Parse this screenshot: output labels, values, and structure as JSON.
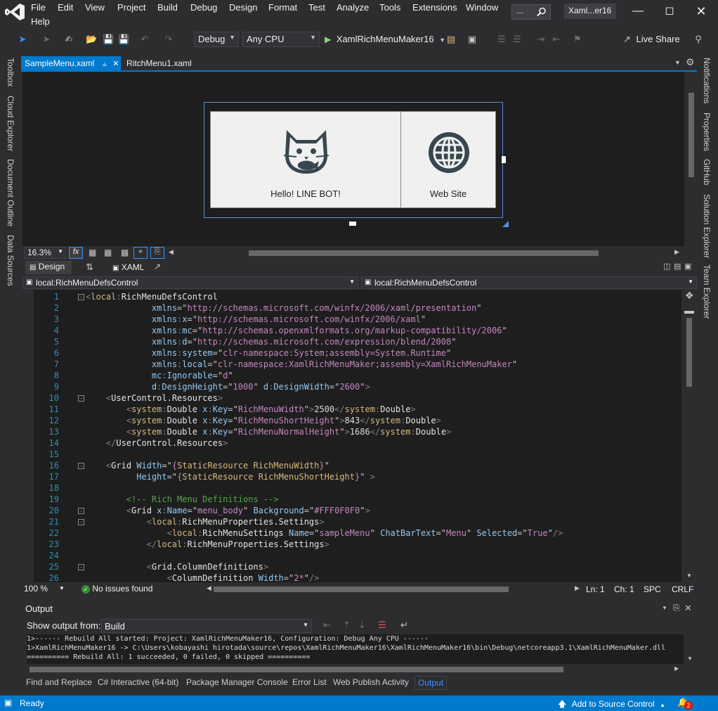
{
  "menubar": {
    "items": [
      "File",
      "Edit",
      "View",
      "Project",
      "Build",
      "Debug",
      "Design",
      "Format",
      "Test",
      "Analyze",
      "Tools",
      "Extensions",
      "Window",
      "Help"
    ],
    "search_label": "...",
    "solution_name": "Xaml...er16"
  },
  "toolbar": {
    "configuration": "Debug",
    "platform": "Any CPU",
    "start_target": "XamlRichMenuMaker16",
    "live_share": "Live Share"
  },
  "left_tabs": [
    "Toolbox",
    "Cloud Explorer",
    "Document Outline",
    "Data Sources"
  ],
  "right_tabs": [
    "Notifications",
    "Properties",
    "GitHub",
    "Solution Explorer",
    "Team Explorer"
  ],
  "doc_tabs": [
    {
      "label": "SampleMenu.xaml",
      "pin": "⫨"
    },
    {
      "label": "RitchMenu1.xaml"
    }
  ],
  "designer": {
    "cells": [
      {
        "label": "Hello! LINE BOT!",
        "icon": "cat-icon"
      },
      {
        "label": "Web Site",
        "icon": "globe-icon"
      }
    ],
    "zoom": "16.3%",
    "fx_label": "fx"
  },
  "split": {
    "design_label": "Design",
    "xaml_label": "XAML"
  },
  "nav": {
    "left_scope": "local:RichMenuDefsControl",
    "right_scope": "local:RichMenuDefsControl"
  },
  "code_lines": [
    {
      "n": "1",
      "fold": "-",
      "html": "<span class='c-bracket'>&lt;</span><span class='c-ns'>local</span><span class='c-bracket'>:</span><span class='c-tag'>RichMenuDefsControl</span>"
    },
    {
      "n": "2",
      "html": "             <span class='c-attr'>xmlns</span><span class='c-q'>=</span><span class='c-q'>\"</span><span class='c-str'>http://schemas.microsoft.com/winfx/2006/xaml/presentation</span><span class='c-q'>\"</span>"
    },
    {
      "n": "3",
      "html": "             <span class='c-attr'>xmlns</span><span class='c-bracket'>:</span><span class='c-attr'>x</span><span class='c-q'>=\"</span><span class='c-str'>http://schemas.microsoft.com/winfx/2006/xaml</span><span class='c-q'>\"</span>"
    },
    {
      "n": "4",
      "html": "             <span class='c-attr'>xmlns</span><span class='c-bracket'>:</span><span class='c-attr'>mc</span><span class='c-q'>=\"</span><span class='c-str'>http://schemas.openxmlformats.org/markup-compatibility/2006</span><span class='c-q'>\"</span>"
    },
    {
      "n": "5",
      "html": "             <span class='c-attr'>xmlns</span><span class='c-bracket'>:</span><span class='c-attr'>d</span><span class='c-q'>=\"</span><span class='c-str'>http://schemas.microsoft.com/expression/blend/2008</span><span class='c-q'>\"</span>"
    },
    {
      "n": "6",
      "html": "             <span class='c-attr'>xmlns</span><span class='c-bracket'>:</span><span class='c-attr'>system</span><span class='c-q'>=\"</span><span class='c-str'>clr-namespace:System;assembly=System.Runtime</span><span class='c-q'>\"</span>"
    },
    {
      "n": "7",
      "html": "             <span class='c-attr'>xmlns</span><span class='c-bracket'>:</span><span class='c-attr'>local</span><span class='c-q'>=\"</span><span class='c-str'>clr-namespace:XamlRichMenuMaker;assembly=XamlRichMenuMaker</span><span class='c-q'>\"</span>"
    },
    {
      "n": "8",
      "html": "             <span class='c-attr'>mc</span><span class='c-bracket'>:</span><span class='c-attr'>Ignorable</span><span class='c-q'>=\"</span><span class='c-str'>d</span><span class='c-q'>\"</span>"
    },
    {
      "n": "9",
      "html": "             <span class='c-attr'>d</span><span class='c-bracket'>:</span><span class='c-attr'>DesignHeight</span><span class='c-q'>=\"</span><span class='c-str'>1000</span><span class='c-q'>\"</span> <span class='c-attr'>d</span><span class='c-bracket'>:</span><span class='c-attr'>DesignWidth</span><span class='c-q'>=\"</span><span class='c-str'>2600</span><span class='c-q'>\"</span><span class='c-bracket'>&gt;</span>"
    },
    {
      "n": "10",
      "fold": "-",
      "html": "    <span class='c-bracket'>&lt;</span><span class='c-tag'>UserControl.Resources</span><span class='c-bracket'>&gt;</span>"
    },
    {
      "n": "11",
      "html": "        <span class='c-bracket'>&lt;</span><span class='c-ns'>system</span><span class='c-bracket'>:</span><span class='c-tag'>Double</span> <span class='c-attr'>x</span><span class='c-bracket'>:</span><span class='c-attr'>Key</span><span class='c-q'>=\"</span><span class='c-str'>RichMenuWidth</span><span class='c-q'>\"</span><span class='c-bracket'>&gt;</span><span class='c-text'>2500</span><span class='c-bracket'>&lt;/</span><span class='c-ns'>system</span><span class='c-bracket'>:</span><span class='c-tag'>Double</span><span class='c-bracket'>&gt;</span>"
    },
    {
      "n": "12",
      "html": "        <span class='c-bracket'>&lt;</span><span class='c-ns'>system</span><span class='c-bracket'>:</span><span class='c-tag'>Double</span> <span class='c-attr'>x</span><span class='c-bracket'>:</span><span class='c-attr'>Key</span><span class='c-q'>=\"</span><span class='c-str'>RichMenuShortHeight</span><span class='c-q'>\"</span><span class='c-bracket'>&gt;</span><span class='c-text'>843</span><span class='c-bracket'>&lt;/</span><span class='c-ns'>system</span><span class='c-bracket'>:</span><span class='c-tag'>Double</span><span class='c-bracket'>&gt;</span>"
    },
    {
      "n": "13",
      "html": "        <span class='c-bracket'>&lt;</span><span class='c-ns'>system</span><span class='c-bracket'>:</span><span class='c-tag'>Double</span> <span class='c-attr'>x</span><span class='c-bracket'>:</span><span class='c-attr'>Key</span><span class='c-q'>=\"</span><span class='c-str'>RichMenuNormalHeight</span><span class='c-q'>\"</span><span class='c-bracket'>&gt;</span><span class='c-text'>1686</span><span class='c-bracket'>&lt;/</span><span class='c-ns'>system</span><span class='c-bracket'>:</span><span class='c-tag'>Double</span><span class='c-bracket'>&gt;</span>"
    },
    {
      "n": "14",
      "html": "    <span class='c-bracket'>&lt;/</span><span class='c-tag'>UserControl.Resources</span><span class='c-bracket'>&gt;</span>"
    },
    {
      "n": "15",
      "html": ""
    },
    {
      "n": "16",
      "fold": "-",
      "html": "    <span class='c-bracket'>&lt;</span><span class='c-tag'>Grid</span> <span class='c-attr'>Width</span><span class='c-q'>=\"</span><span class='c-str'>{</span><span class='c-ns'>StaticResource</span> <span class='c-ns'>RichMenuWidth</span><span class='c-str'>}</span><span class='c-q'>\"</span>"
    },
    {
      "n": "17",
      "html": "          <span class='c-attr'>Height</span><span class='c-q'>=\"</span><span class='c-str'>{</span><span class='c-ns'>StaticResource</span> <span class='c-ns'>RichMenuShortHeight</span><span class='c-str'>}</span><span class='c-q'>\"</span> <span class='c-bracket'>&gt;</span>"
    },
    {
      "n": "18",
      "html": ""
    },
    {
      "n": "19",
      "html": "        <span class='c-com'>&lt;!-- Rich Menu Definitions --&gt;</span>"
    },
    {
      "n": "20",
      "fold": "-",
      "html": "        <span class='c-bracket'>&lt;</span><span class='c-tag'>Grid</span> <span class='c-attr'>x</span><span class='c-bracket'>:</span><span class='c-attr'>Name</span><span class='c-q'>=\"</span><span class='c-str'>menu_body</span><span class='c-q'>\"</span> <span class='c-attr'>Background</span><span class='c-q'>=\"</span><span class='c-str'>#FFF0F0F0</span><span class='c-q'>\"</span><span class='c-bracket'>&gt;</span>"
    },
    {
      "n": "21",
      "fold": "-",
      "html": "            <span class='c-bracket'>&lt;</span><span class='c-ns'>local</span><span class='c-bracket'>:</span><span class='c-tag'>RichMenuProperties.Settings</span><span class='c-bracket'>&gt;</span>"
    },
    {
      "n": "22",
      "html": "                <span class='c-bracket'>&lt;</span><span class='c-ns'>local</span><span class='c-bracket'>:</span><span class='c-tag'>RichMenuSettings</span> <span class='c-attr'>Name</span><span class='c-q'>=\"</span><span class='c-str'>sampleMenu</span><span class='c-q'>\"</span> <span class='c-attr'>ChatBarText</span><span class='c-q'>=\"</span><span class='c-str'>Menu</span><span class='c-q'>\"</span> <span class='c-attr'>Selected</span><span class='c-q'>=\"</span><span class='c-str'>True</span><span class='c-q'>\"</span><span class='c-bracket'>/&gt;</span>"
    },
    {
      "n": "23",
      "html": "            <span class='c-bracket'>&lt;/</span><span class='c-ns'>local</span><span class='c-bracket'>:</span><span class='c-tag'>RichMenuProperties.Settings</span><span class='c-bracket'>&gt;</span>"
    },
    {
      "n": "24",
      "html": ""
    },
    {
      "n": "25",
      "fold": "-",
      "html": "            <span class='c-bracket'>&lt;</span><span class='c-tag'>Grid.ColumnDefinitions</span><span class='c-bracket'>&gt;</span>"
    },
    {
      "n": "26",
      "html": "                <span class='c-bracket'>&lt;</span><span class='c-tag'>ColumnDefinition</span> <span class='c-attr'>Width</span><span class='c-q'>=\"</span><span class='c-str'>2*</span><span class='c-q'>\"</span><span class='c-bracket'>/&gt;</span>"
    }
  ],
  "editor_status": {
    "zoom": "100 %",
    "issues": "No issues found",
    "ln": "Ln: 1",
    "ch": "Ch: 1",
    "spc": "SPC",
    "crlf": "CRLF"
  },
  "output": {
    "title": "Output",
    "show_from_label": "Show output from:",
    "source": "Build",
    "lines": [
      "1>------ Rebuild All started: Project: XamlRichMenuMaker16, Configuration: Debug Any CPU ------",
      "1>XamlRichMenuMaker16 -> C:\\Users\\kobayashi hirotada\\source\\repos\\XamlRichMenuMaker16\\XamlRichMenuMaker16\\bin\\Debug\\netcoreapp3.1\\XamlRichMenuMaker.dll",
      "========== Rebuild All: 1 succeeded, 0 failed, 0 skipped =========="
    ]
  },
  "bottom_tabs": [
    "Find and Replace",
    "C# Interactive (64-bit)",
    "Package Manager Console",
    "Error List",
    "Web Publish Activity",
    "Output"
  ],
  "statusbar": {
    "ready": "Ready",
    "source_control": "Add to Source Control",
    "notification_count": "2"
  },
  "colors": {
    "accent": "#007acc",
    "editor_bg": "#1e1e1e",
    "chrome_bg": "#2d2d30"
  }
}
